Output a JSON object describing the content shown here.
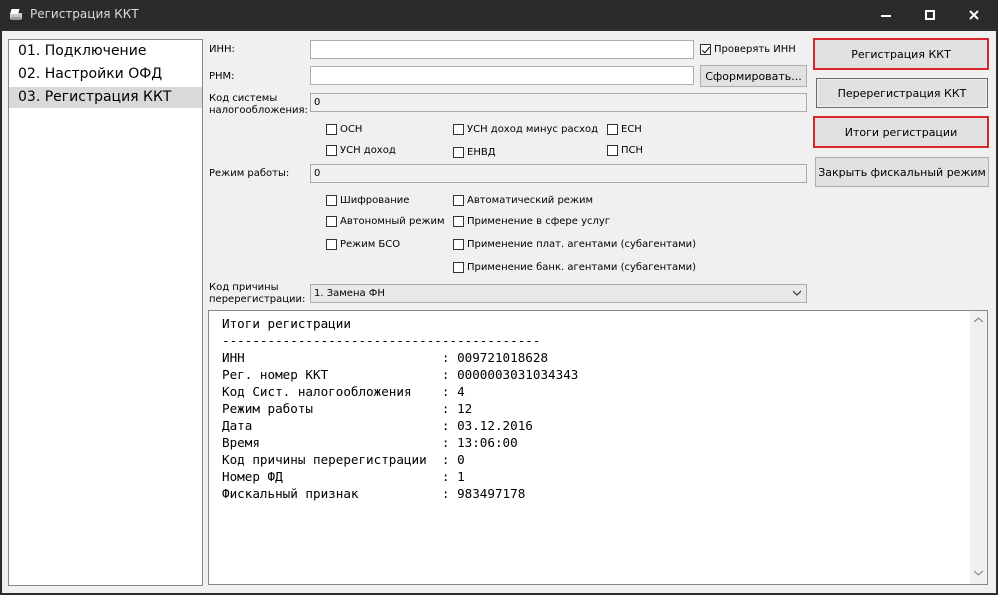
{
  "window": {
    "title": "Регистрация ККТ"
  },
  "nav": {
    "items": [
      {
        "label": "01. Подключение"
      },
      {
        "label": "02. Настройки ОФД"
      },
      {
        "label": "03. Регистрация ККТ"
      }
    ],
    "selected_index": 2
  },
  "form": {
    "inn_label": "ИНН:",
    "inn_value": "",
    "check_inn_label": "Проверять ИНН",
    "check_inn_checked": true,
    "rnm_label": "РНМ:",
    "rnm_value": "",
    "generate_button": "Сформировать...",
    "tax_system_label": "Код системы налогообложения:",
    "tax_system_value": "0",
    "tax_options": [
      "ОСН",
      "УСН доход",
      "УСН доход минус расход",
      "ЕНВД",
      "ЕСН",
      "ПСН"
    ],
    "work_mode_label": "Режим работы:",
    "work_mode_value": "0",
    "work_mode_options": [
      "Шифрование",
      "Автономный режим",
      "Режим БСО",
      "Автоматический режим",
      "Применение в сфере услуг",
      "Применение плат. агентами (субагентами)",
      "Применение банк. агентами (субагентами)"
    ],
    "reason_label": "Код причины перерегистрации:",
    "reason_value": "1. Замена ФН"
  },
  "actions": {
    "register": "Регистрация ККТ",
    "reregister": "Перерегистрация ККТ",
    "results": "Итоги регистрации",
    "close_fiscal": "Закрыть фискальный режим"
  },
  "report": {
    "title": "Итоги регистрации",
    "separator": "------------------------------------------",
    "rows": [
      {
        "key": "ИНН",
        "value": "009721018628"
      },
      {
        "key": "Рег. номер ККТ",
        "value": "0000003031034343"
      },
      {
        "key": "Код Сист. налогообложения",
        "value": "4"
      },
      {
        "key": "Режим работы",
        "value": "12"
      },
      {
        "key": "Дата",
        "value": "03.12.2016"
      },
      {
        "key": "Время",
        "value": "13:06:00"
      },
      {
        "key": "Код причины перерегистрации",
        "value": "0"
      },
      {
        "key": "Номер ФД",
        "value": "1"
      },
      {
        "key": "Фискальный признак",
        "value": "983497178"
      }
    ]
  },
  "colors": {
    "titlebar": "#2b2b2b",
    "accent_red": "#d9262c",
    "selected": "#d9d9d9"
  },
  "icons": {
    "app": "printer-icon",
    "minimize": "minimize-icon",
    "maximize": "maximize-icon",
    "close": "close-icon"
  }
}
